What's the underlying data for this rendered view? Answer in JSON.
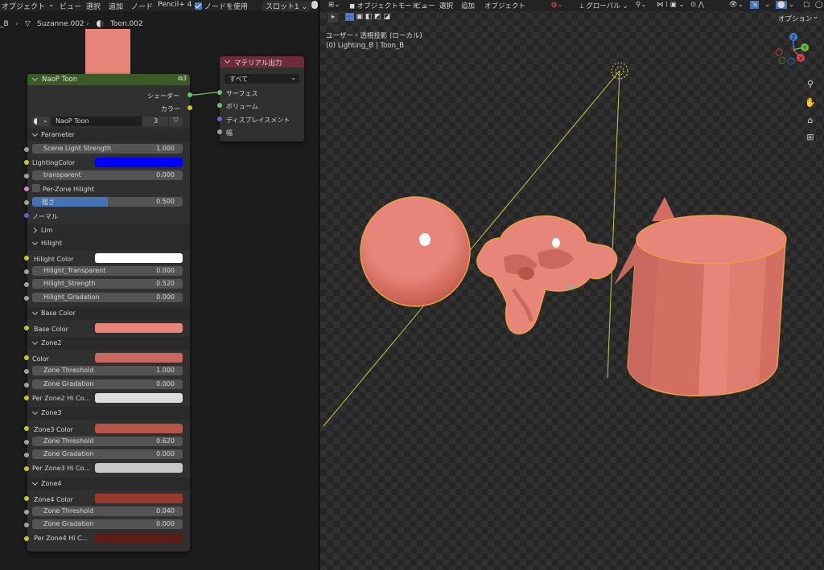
{
  "node_editor": {
    "menu": [
      "オブジェクト",
      "ビュー",
      "選択",
      "追加",
      "ノード",
      "Pencil+ 4"
    ],
    "use_nodes_label": "ノードを使用",
    "slot": "スロット1",
    "breadcrumb": [
      "_B",
      "Suzanne.002",
      "Toon.002"
    ]
  },
  "naop_node": {
    "title": "NaoP Toon",
    "user_count": "3",
    "outputs": [
      "シェーダー",
      "カラー"
    ],
    "material_name": "NaoP Toon",
    "material_users": "3",
    "sections": {
      "parameter": "Parameter",
      "lim": "Lim",
      "hilight": "Hilight",
      "base_color": "Base Color",
      "zone2": "Zone2",
      "zone3": "Zone3",
      "zone4": "Zone4"
    },
    "fields": {
      "scene_light_strength": {
        "label": "Scene Light Strength",
        "value": "1.000"
      },
      "lighting_color": {
        "label": "LightingColor",
        "color": "#0000ff"
      },
      "transparent": {
        "label": "transparent",
        "value": "0.000"
      },
      "per_zone_hilight": {
        "label": "Per-Zone Hilight"
      },
      "roughness": {
        "label": "粗さ",
        "value": "0.500",
        "fraction": 0.5
      },
      "normal": {
        "label": "ノーマル"
      },
      "hilight_color": {
        "label": "Hilight Color",
        "color": "#ffffff"
      },
      "hilight_transparent": {
        "label": "Hilight_Transparent",
        "value": "0.000"
      },
      "hilight_strength": {
        "label": "Hilight_Strength",
        "value": "0.520"
      },
      "hilight_gradation": {
        "label": "Hilight_Gradation",
        "value": "0.000"
      },
      "base_color": {
        "label": "Base Color",
        "color": "#e8857a"
      },
      "zone2_color": {
        "label": "Color",
        "color": "#c8685e"
      },
      "zone2_threshold": {
        "label": "Zone Threshold",
        "value": "1.000"
      },
      "zone2_gradation": {
        "label": "Zone Gradation",
        "value": "0.000"
      },
      "zone2_hi": {
        "label": "Per Zone2 Hi Co...",
        "color": "#dcdcdc"
      },
      "zone3_color": {
        "label": "Zone3 Color",
        "color": "#b85548"
      },
      "zone3_threshold": {
        "label": "Zone Threshold",
        "value": "0.620"
      },
      "zone3_gradation": {
        "label": "Zone Gradation",
        "value": "0.000"
      },
      "zone3_hi": {
        "label": "Per Zone3 Hi Co...",
        "color": "#c8c8c8"
      },
      "zone4_color": {
        "label": "Zone4 Color",
        "color": "#983a2c"
      },
      "zone4_threshold": {
        "label": "Zone Threshold",
        "value": "0.040"
      },
      "zone4_gradation": {
        "label": "Zone Gradation",
        "value": "0.000"
      },
      "zone4_hi": {
        "label": "Per Zone4 Hi C...",
        "color": "#5a1d15"
      }
    }
  },
  "output_node": {
    "title": "マテリアル出力",
    "target": "すべて",
    "inputs": [
      "サーフェス",
      "ボリューム",
      "ディスプレイスメント",
      "幅"
    ]
  },
  "viewport": {
    "menu": [
      "オブジェクトモード",
      "ビュー",
      "選択",
      "追加",
      "オブジェクト"
    ],
    "transform": "グローバル",
    "options": "オプション",
    "view_name": "ユーザー・透視投影 (ローカル)",
    "object_info": "(0) Lighting_B | Toon_B",
    "gizmo_labels": [
      "Z",
      "Y",
      "X"
    ]
  },
  "colors": {
    "header_green": "#3b5a26",
    "header_red": "#6e2b3b",
    "toon_base": "#e8857a",
    "selection": "#e8a23a"
  }
}
